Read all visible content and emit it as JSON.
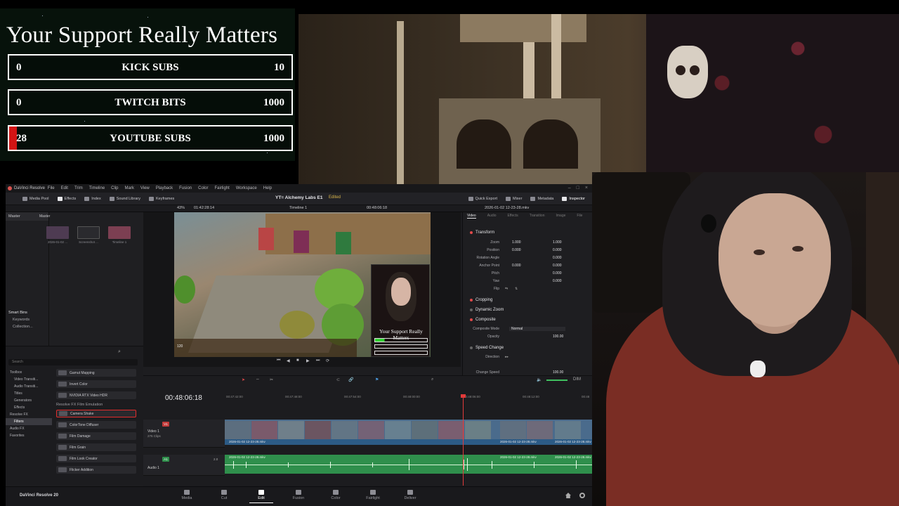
{
  "goals": {
    "title": "Your Support Really Matters",
    "bars": [
      {
        "current": "0",
        "label": "KICK SUBS",
        "max": "10",
        "progress": 0.0
      },
      {
        "current": "0",
        "label": "TWITCH BITS",
        "max": "1000",
        "progress": 0.0
      },
      {
        "current": "28",
        "label": "YOUTUBE SUBS",
        "max": "1000",
        "progress": 0.028
      }
    ]
  },
  "resolve": {
    "title": "DaVinci Resolve",
    "menu": [
      "File",
      "Edit",
      "Trim",
      "Timeline",
      "Clip",
      "Mark",
      "View",
      "Playback",
      "Fusion",
      "Color",
      "Fairlight",
      "Workspace",
      "Help"
    ],
    "toolbar_left": [
      "Media Pool",
      "Effects",
      "Index",
      "Sound Library",
      "Keyframes"
    ],
    "project_name": "YT= Alchemy Labs E1",
    "project_status": "Edited",
    "toolbar_right": [
      "Quick Export",
      "Mixer",
      "Metadata",
      "Inspector"
    ],
    "subbar": {
      "zoom": "43%",
      "source_tc": "01:42:28:14",
      "timeline_name": "Timeline 1",
      "record_tc": "00:48:06:18",
      "clip_name": "2026-01-02 12-23-28.mkv"
    },
    "media_pool": {
      "bin": "Master",
      "header": "Master",
      "clips": [
        {
          "name": "2026-01-02 ...",
          "color": "#4e3b52"
        },
        {
          "name": "Screenshot ...",
          "color": "#2a2a2e"
        },
        {
          "name": "Timeline 1",
          "color": "#7c3f52"
        }
      ],
      "smart_bins_title": "Smart Bins",
      "smart_bins": [
        "Keywords",
        "Collection..."
      ]
    },
    "effects": {
      "search_placeholder": "Search",
      "tree": [
        "Toolbox",
        "Video Transiti...",
        "Audio Transiti...",
        "Titles",
        "Generators",
        "Effects",
        "Resolve FX",
        "Filters",
        "Audio FX",
        "Favorites"
      ],
      "selected_tree": "Filters",
      "items_top": [
        "Gamut Mapping",
        "Invert Color",
        "NVIDIA RTX Video HDR"
      ],
      "group_label": "Resolve FX Film Emulation",
      "items": [
        "Camera Shake",
        "ColorTone Diffuser",
        "Film Damage",
        "Film Grain",
        "Film Look Creator",
        "Flicker Addition"
      ],
      "highlighted_item": "Camera Shake"
    },
    "viewer": {
      "pip_title": "Your Support Really Matters",
      "hud_value": "120"
    },
    "inspector": {
      "tabs": [
        "Video",
        "Audio",
        "Effects",
        "Transition",
        "Image",
        "File"
      ],
      "active_tab": "Video",
      "sections": [
        "Transform",
        "Cropping",
        "Dynamic Zoom",
        "Composite",
        "Speed Change"
      ],
      "transform_rows": [
        {
          "label": "Zoom",
          "x": "1.000",
          "y": "1.000"
        },
        {
          "label": "Position",
          "x": "0.000",
          "y": "0.000"
        },
        {
          "label": "Rotation Angle",
          "x": "",
          "y": "0.000"
        },
        {
          "label": "Anchor Point",
          "x": "0.000",
          "y": "0.000"
        },
        {
          "label": "Pitch",
          "x": "",
          "y": "0.000"
        },
        {
          "label": "Yaw",
          "x": "",
          "y": "0.000"
        },
        {
          "label": "Flip",
          "x": "",
          "y": ""
        }
      ],
      "composite_mode_label": "Composite Mode",
      "composite_mode": "Normal",
      "opacity_label": "Opacity",
      "opacity": "100.00",
      "direction_label": "Direction",
      "change_speed_label": "Change Speed",
      "change_speed": "100.00"
    },
    "timeline": {
      "timecode": "00:48:06:18",
      "ruler": [
        "00:47:42:00",
        "00:47:48:00",
        "00:47:54:00",
        "00:48:00:00",
        "00:48:06:00",
        "00:48:12:00",
        "00:48"
      ],
      "video_track": {
        "tag": "V1",
        "name": "Video 1",
        "sub": "276 Clips",
        "clip_label": "2026-01-02 12-23-28.mkv",
        "tail_labels": [
          "2026-01-02 12-23-28.mkv",
          "2026-01-02 12-23-28.mkv"
        ]
      },
      "audio_track": {
        "tag": "A1",
        "name": "Audio 1",
        "level": "2.0",
        "clip_label": "2026-01-02 12-23-28.mkv",
        "tail_labels": [
          "2026-01-02 12-23-28.mkv",
          "2026-01-02 12-23-28.mkv"
        ]
      },
      "dim_label": "DIM"
    },
    "pages": {
      "brand": "DaVinci Resolve 20",
      "items": [
        "Media",
        "Cut",
        "Edit",
        "Fusion",
        "Color",
        "Fairlight",
        "Deliver"
      ],
      "active": "Edit"
    }
  }
}
